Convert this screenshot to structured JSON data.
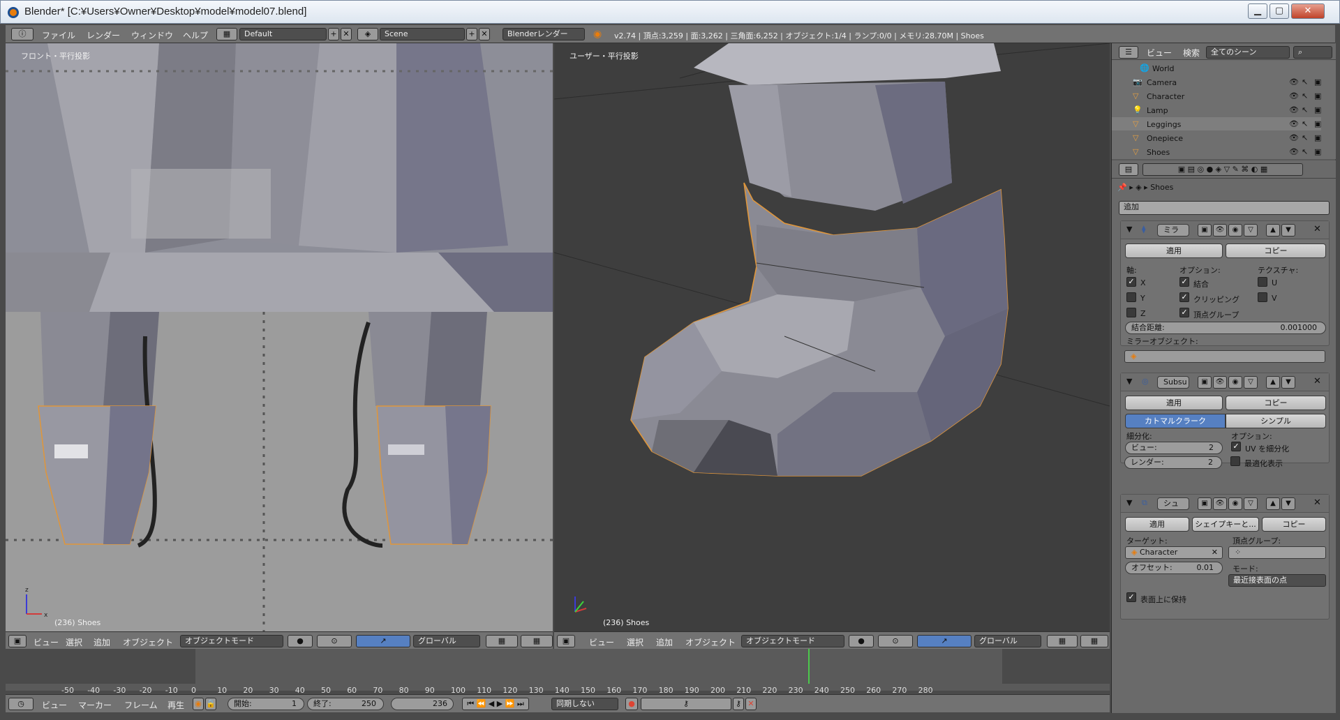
{
  "window": {
    "title": "Blender* [C:¥Users¥Owner¥Desktop¥model¥model07.blend]"
  },
  "topbar": {
    "menus": [
      "ファイル",
      "レンダー",
      "ウィンドウ",
      "ヘルプ"
    ],
    "layout": "Default",
    "scene": "Scene",
    "engine": "Blenderレンダー",
    "stats": "v2.74 | 頂点:3,259 | 面:3,262 | 三角面:6,252 | オブジェクト:1/4 | ランプ:0/0 | メモリ:28.70M | Shoes"
  },
  "viewport_left": {
    "label": "フロント・平行投影",
    "object": "(236) Shoes"
  },
  "viewport_right": {
    "label": "ユーザー・平行投影",
    "object": "(236) Shoes"
  },
  "view_header": {
    "menus": [
      "ビュー",
      "選択",
      "追加",
      "オブジェクト"
    ],
    "mode": "オブジェクトモード",
    "orientation": "グローバル"
  },
  "timeline": {
    "ticks": [
      "-50",
      "-40",
      "-30",
      "-20",
      "-10",
      "0",
      "10",
      "20",
      "30",
      "40",
      "50",
      "60",
      "70",
      "80",
      "90",
      "100",
      "110",
      "120",
      "130",
      "140",
      "150",
      "160",
      "170",
      "180",
      "190",
      "200",
      "210",
      "220",
      "230",
      "240",
      "250",
      "260",
      "270",
      "280"
    ],
    "current_frame": 236
  },
  "footer": {
    "menus": [
      "ビュー",
      "マーカー",
      "フレーム",
      "再生"
    ],
    "start_label": "開始:",
    "start": "1",
    "end_label": "終了:",
    "end": "250",
    "frame": "236",
    "sync": "同期しない"
  },
  "outliner": {
    "menus": [
      "ビュー",
      "検索"
    ],
    "scene_filter": "全てのシーン",
    "items": [
      "World",
      "Camera",
      "Character",
      "Lamp",
      "Leggings",
      "Onepiece",
      "Shoes"
    ]
  },
  "properties": {
    "breadcrumb": "Shoes",
    "add_modifier": "追加",
    "mirror": {
      "name": "ミラ",
      "apply": "適用",
      "copy": "コピー",
      "axis_label": "軸:",
      "options_label": "オプション:",
      "texture_label": "テクスチャ:",
      "x": "X",
      "y": "Y",
      "z": "Z",
      "merge": "結合",
      "clipping": "クリッピング",
      "vertex_group": "頂点グループ",
      "u": "U",
      "v": "V",
      "merge_dist_label": "結合距離:",
      "merge_dist": "0.001000",
      "mirror_object_label": "ミラーオブジェクト:"
    },
    "subsurf": {
      "name": "Subsu",
      "apply": "適用",
      "copy": "コピー",
      "catmull": "カトマルクラーク",
      "simple": "シンプル",
      "subdiv_label": "細分化:",
      "options_label": "オプション:",
      "view_label": "ビュー:",
      "view_val": "2",
      "render_label": "レンダー:",
      "render_val": "2",
      "subdivide_uvs": "UV を細分化",
      "optimal_display": "最適化表示"
    },
    "shrinkwrap": {
      "name": "シュ",
      "apply": "適用",
      "shape": "シェイプキーと...",
      "copy": "コピー",
      "target_label": "ターゲット:",
      "target": "Character",
      "vgroup_label": "頂点グループ:",
      "offset_label": "オフセット:",
      "offset": "0.01",
      "mode_label": "モード:",
      "mode": "最近接表面の点",
      "keep_above": "表面上に保持"
    }
  }
}
